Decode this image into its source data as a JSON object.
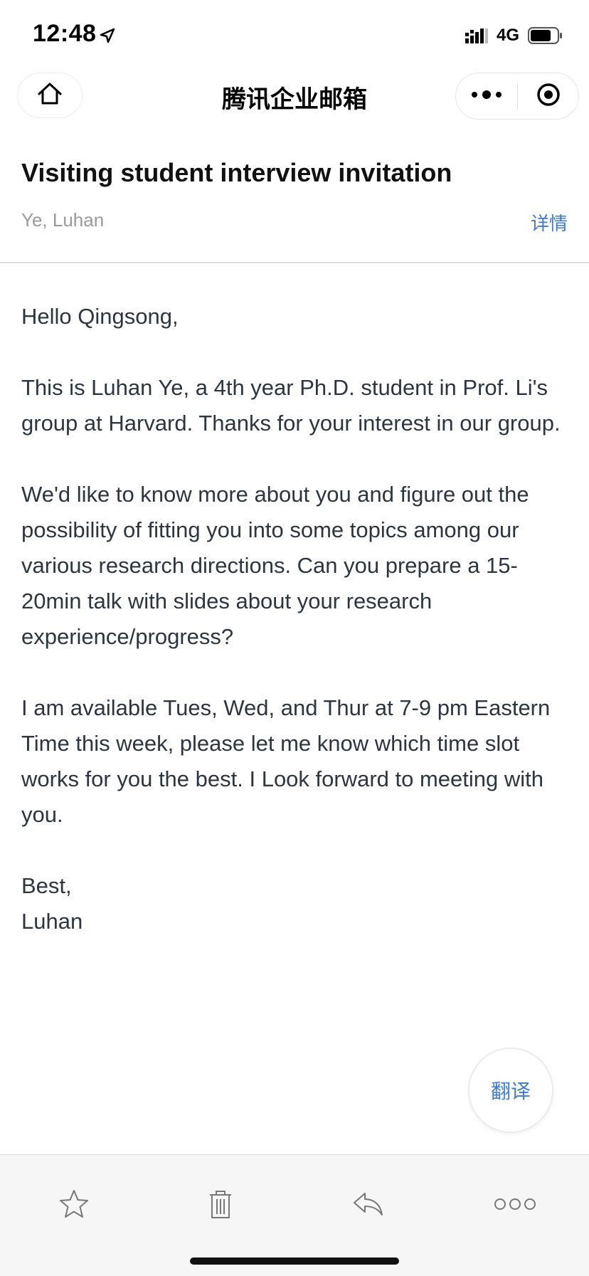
{
  "status_bar": {
    "time": "12:48",
    "network": "4G",
    "icons": [
      "location-arrow-icon",
      "signal-icon",
      "battery-icon"
    ]
  },
  "nav": {
    "title": "腾讯企业邮箱",
    "icons": [
      "home-icon",
      "more-dots-icon",
      "close-target-icon"
    ]
  },
  "email": {
    "subject": "Visiting student interview invitation",
    "sender": "Ye, Luhan",
    "details_label": "详情",
    "greeting": "Hello Qingsong,",
    "paragraph1": "This is Luhan Ye, a 4th year Ph.D. student in Prof. Li's group at Harvard. Thanks for your interest in our group.",
    "paragraph2": "We'd like to know more about you and figure out the possibility of fitting you into some topics among our various research directions. Can you prepare a 15-20min talk with slides about your research experience/progress?",
    "paragraph3": "I am available Tues, Wed, and Thur at 7-9 pm Eastern Time this week, please let me know which time slot works for you the best. I Look forward to meeting with you.",
    "signoff": "Best,",
    "signature": "Luhan"
  },
  "translate_label": "翻译",
  "toolbar": {
    "icons": [
      "star-icon",
      "trash-icon",
      "reply-icon",
      "more-circles-icon"
    ]
  },
  "colors": {
    "accent": "#3d7bd3",
    "body_text": "#2d3540",
    "muted": "#9a9a9a",
    "toolbar_bg": "#f6f6f6"
  }
}
